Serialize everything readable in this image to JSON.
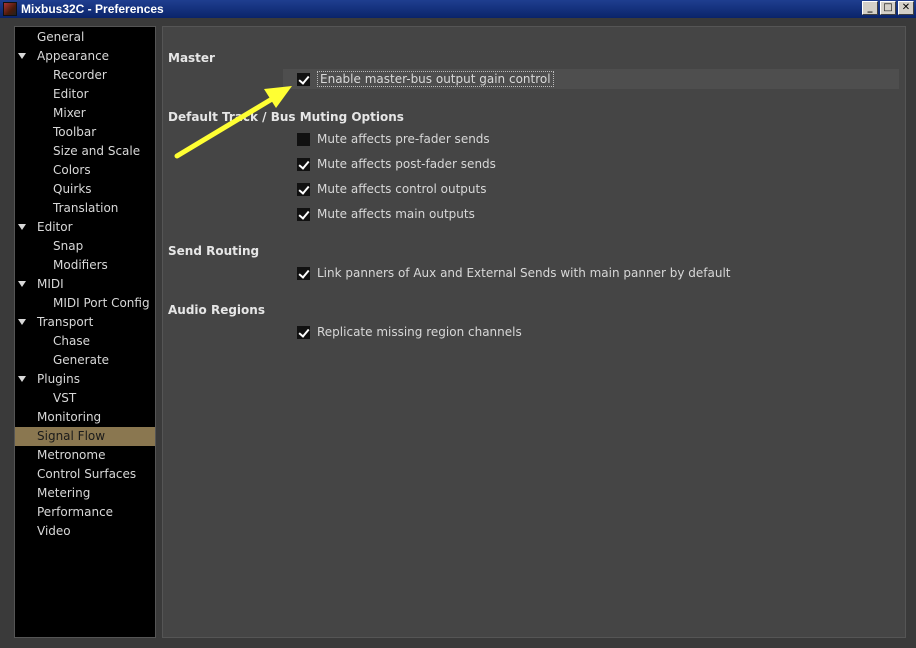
{
  "window": {
    "title": "Mixbus32C - Preferences",
    "controls": {
      "minimize": "_",
      "maximize": "□",
      "close": "✕"
    }
  },
  "sidebar": {
    "items": [
      {
        "label": "General",
        "level": 0,
        "expanded": false,
        "selected": false
      },
      {
        "label": "Appearance",
        "level": 0,
        "expanded": true,
        "selected": false
      },
      {
        "label": "Recorder",
        "level": 1,
        "selected": false
      },
      {
        "label": "Editor",
        "level": 1,
        "selected": false
      },
      {
        "label": "Mixer",
        "level": 1,
        "selected": false
      },
      {
        "label": "Toolbar",
        "level": 1,
        "selected": false
      },
      {
        "label": "Size and Scale",
        "level": 1,
        "selected": false
      },
      {
        "label": "Colors",
        "level": 1,
        "selected": false
      },
      {
        "label": "Quirks",
        "level": 1,
        "selected": false
      },
      {
        "label": "Translation",
        "level": 1,
        "selected": false
      },
      {
        "label": "Editor",
        "level": 0,
        "expanded": true,
        "selected": false
      },
      {
        "label": "Snap",
        "level": 1,
        "selected": false
      },
      {
        "label": "Modifiers",
        "level": 1,
        "selected": false
      },
      {
        "label": "MIDI",
        "level": 0,
        "expanded": true,
        "selected": false
      },
      {
        "label": "MIDI Port Config",
        "level": 1,
        "selected": false
      },
      {
        "label": "Transport",
        "level": 0,
        "expanded": true,
        "selected": false
      },
      {
        "label": "Chase",
        "level": 1,
        "selected": false
      },
      {
        "label": "Generate",
        "level": 1,
        "selected": false
      },
      {
        "label": "Plugins",
        "level": 0,
        "expanded": true,
        "selected": false
      },
      {
        "label": "VST",
        "level": 1,
        "selected": false
      },
      {
        "label": "Monitoring",
        "level": 0,
        "expanded": false,
        "selected": false
      },
      {
        "label": "Signal Flow",
        "level": 0,
        "expanded": false,
        "selected": true
      },
      {
        "label": "Metronome",
        "level": 0,
        "expanded": false,
        "selected": false
      },
      {
        "label": "Control Surfaces",
        "level": 0,
        "expanded": false,
        "selected": false
      },
      {
        "label": "Metering",
        "level": 0,
        "expanded": false,
        "selected": false
      },
      {
        "label": "Performance",
        "level": 0,
        "expanded": false,
        "selected": false
      },
      {
        "label": "Video",
        "level": 0,
        "expanded": false,
        "selected": false
      }
    ]
  },
  "content": {
    "sections": [
      {
        "title": "Master",
        "options": [
          {
            "label": "Enable master-bus output gain control",
            "checked": true,
            "focused": true
          }
        ]
      },
      {
        "title": "Default Track / Bus Muting Options",
        "options": [
          {
            "label": "Mute affects pre-fader sends",
            "checked": false
          },
          {
            "label": "Mute affects post-fader sends",
            "checked": true
          },
          {
            "label": "Mute affects control outputs",
            "checked": true
          },
          {
            "label": "Mute affects main outputs",
            "checked": true
          }
        ]
      },
      {
        "title": "Send Routing",
        "options": [
          {
            "label": "Link panners of Aux and External Sends with main panner by default",
            "checked": true
          }
        ]
      },
      {
        "title": "Audio Regions",
        "options": [
          {
            "label": "Replicate missing region channels",
            "checked": true
          }
        ]
      }
    ]
  },
  "annotation": {
    "color": "#ffff33"
  },
  "colors": {
    "selected_bg": "#8a7750",
    "titlebar": "#0a246a",
    "content_bg": "#454545",
    "sidebar_bg": "#000000"
  }
}
